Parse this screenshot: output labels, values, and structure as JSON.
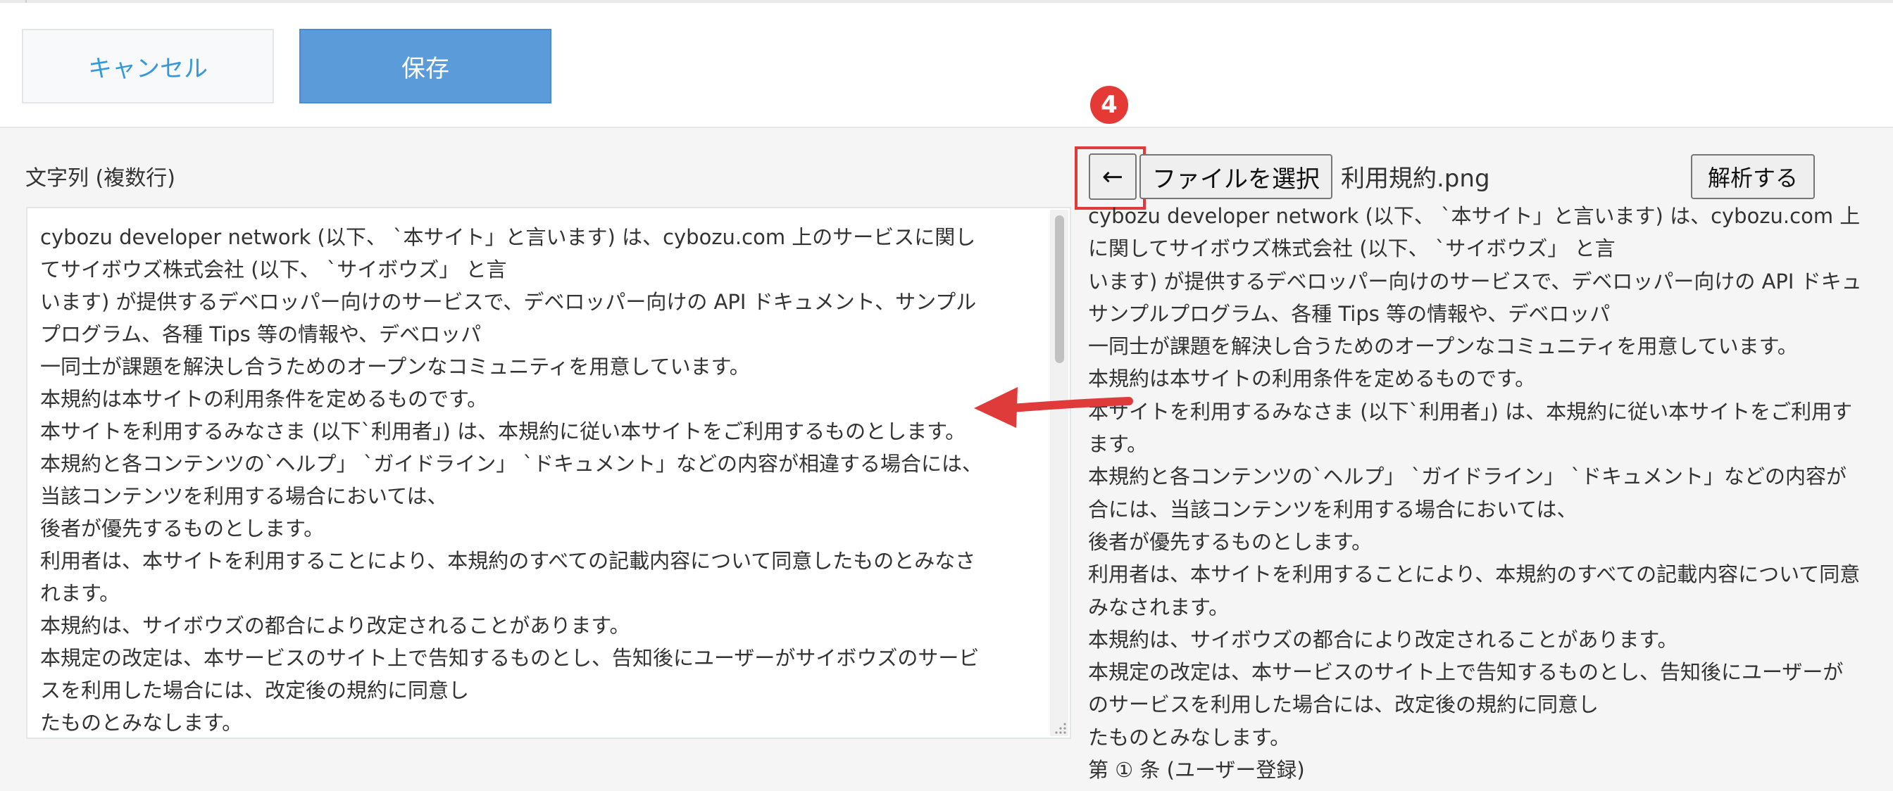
{
  "toolbar": {
    "cancel_label": "キャンセル",
    "save_label": "保存"
  },
  "field": {
    "label": "文字列 (複数行)",
    "lines": [
      "cybozu developer network (以下、 `本サイト」と言います) は、cybozu.com 上のサービスに関し",
      "てサイボウズ株式会社 (以下、 `サイボウズ」 と言",
      "います) が提供するデベロッパー向けのサービスで、デベロッパー向けの API ドキュメント、サンプル",
      "プログラム、各種 Tips 等の情報や、デベロッパ",
      "一同士が課題を解決し合うためのオープンなコミュニティを用意しています。",
      "本規約は本サイトの利用条件を定めるものです。",
      "本サイトを利用するみなさま (以下`利用者」) は、本規約に従い本サイトをご利用するものとします。",
      "本規約と各コンテンツの`ヘルプ」 `ガイドライン」 `ドキュメント」などの内容が相違する場合には、",
      "当該コンテンツを利用する場合においては、",
      "後者が優先するものとします。",
      "利用者は、本サイトを利用することにより、本規約のすべての記載内容について同意したものとみなさ",
      "れます。",
      "本規約は、サイボウズの都合により改定されることがあります。",
      "本規定の改定は、本サービスのサイト上で告知するものとし、告知後にユーザーがサイボウズのサービ",
      "スを利用した場合には、改定後の規約に同意し",
      "たものとみなします。"
    ]
  },
  "annotation": {
    "step_number": "4",
    "accent_color": "#e53935"
  },
  "file_picker": {
    "back_label": "←",
    "choose_label": "ファイルを選択",
    "file_name": "利用規約.png",
    "parse_label": "解析する"
  },
  "result": {
    "lines": [
      "cybozu developer network (以下、 `本サイト」と言います) は、cybozu.com 上",
      "に関してサイボウズ株式会社 (以下、 `サイボウズ」 と言",
      "います) が提供するデベロッパー向けのサービスで、デベロッパー向けの API ドキュ",
      "サンプルプログラム、各種 Tips 等の情報や、デベロッパ",
      "一同士が課題を解決し合うためのオープンなコミュニティを用意しています。",
      "本規約は本サイトの利用条件を定めるものです。",
      "本サイトを利用するみなさま (以下`利用者」) は、本規約に従い本サイトをご利用す",
      "ます。",
      "本規約と各コンテンツの`ヘルプ」 `ガイドライン」 `ドキュメント」などの内容が",
      "合には、当該コンテンツを利用する場合においては、",
      "後者が優先するものとします。",
      "利用者は、本サイトを利用することにより、本規約のすべての記載内容について同意",
      "みなされます。",
      "本規約は、サイボウズの都合により改定されることがあります。",
      "本規定の改定は、本サービスのサイト上で告知するものとし、告知後にユーザーが",
      "のサービスを利用した場合には、改定後の規約に同意し",
      "たものとみなします。",
      "第 ① 条 (ユーザー登録)"
    ]
  }
}
